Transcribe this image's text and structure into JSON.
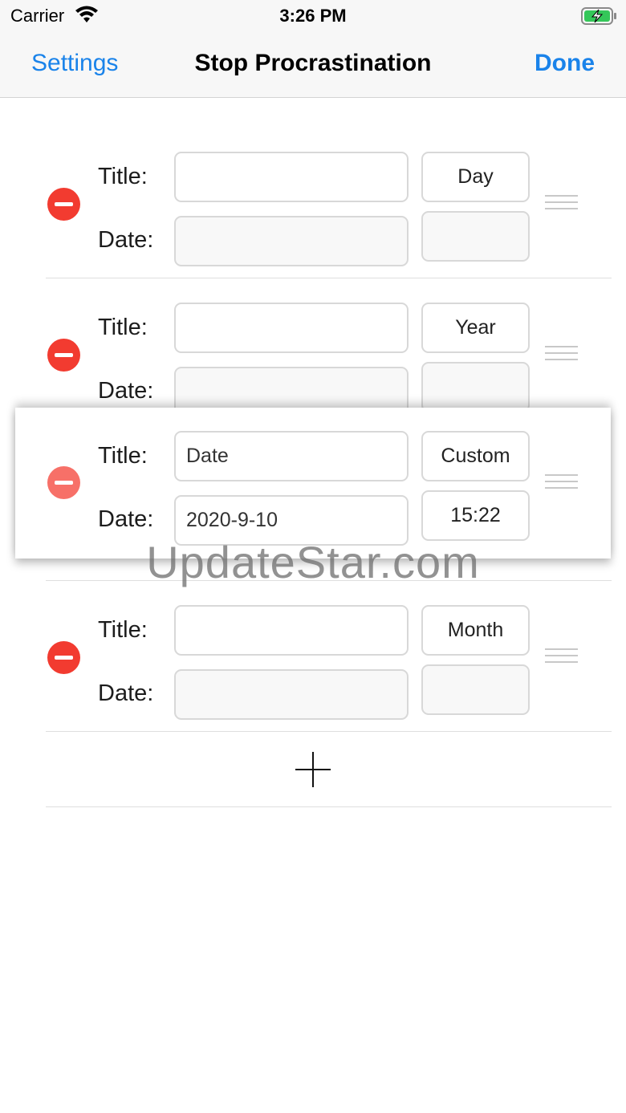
{
  "status": {
    "carrier": "Carrier",
    "time": "3:26 PM"
  },
  "nav": {
    "left": "Settings",
    "title": "Stop Procrastination",
    "right": "Done"
  },
  "labels": {
    "title": "Title:",
    "date": "Date:"
  },
  "rows": [
    {
      "title": "",
      "date": "",
      "unit": "Day",
      "time": ""
    },
    {
      "title": "",
      "date": "",
      "unit": "Year",
      "time": ""
    },
    {
      "title": "Date",
      "date": "2020-9-10",
      "unit": "Custom",
      "time": "15:22"
    },
    {
      "title": "",
      "date": "",
      "unit": "Month",
      "time": ""
    }
  ],
  "watermark": "UpdateStar.com"
}
